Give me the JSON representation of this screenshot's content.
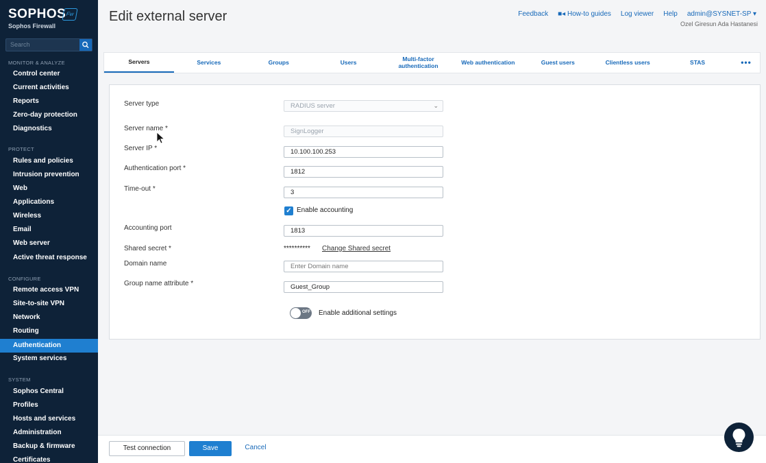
{
  "sidebar": {
    "brand": "SOPHOS",
    "brand_sub": "Sophos Firewall",
    "badge": "Fw",
    "search_placeholder": "Search",
    "sections": {
      "monitor": "MONITOR & ANALYZE",
      "protect": "PROTECT",
      "configure": "CONFIGURE",
      "system": "SYSTEM"
    },
    "monitor_items": [
      "Control center",
      "Current activities",
      "Reports",
      "Zero-day protection",
      "Diagnostics"
    ],
    "protect_items": [
      "Rules and policies",
      "Intrusion prevention",
      "Web",
      "Applications",
      "Wireless",
      "Email",
      "Web server",
      "Active threat response"
    ],
    "configure_items": [
      "Remote access VPN",
      "Site-to-site VPN",
      "Network",
      "Routing",
      "Authentication",
      "System services"
    ],
    "system_items": [
      "Sophos Central",
      "Profiles",
      "Hosts and services",
      "Administration",
      "Backup & firmware",
      "Certificates"
    ],
    "active_item": "Authentication"
  },
  "header": {
    "title": "Edit external server",
    "links": [
      "Feedback",
      "How-to guides",
      "Log viewer",
      "Help"
    ],
    "user": "admin@SYSNET-SP",
    "org": "Ozel Giresun Ada Hastanesi"
  },
  "tabs": [
    {
      "label": "Servers",
      "active": true
    },
    {
      "label": "Services"
    },
    {
      "label": "Groups"
    },
    {
      "label": "Users"
    },
    {
      "label": "Multi-factor authentication"
    },
    {
      "label": "Web authentication"
    },
    {
      "label": "Guest users"
    },
    {
      "label": "Clientless users"
    },
    {
      "label": "STAS"
    },
    {
      "label": "•••"
    }
  ],
  "form": {
    "server_type": {
      "label": "Server type",
      "value": "RADIUS server"
    },
    "server_name": {
      "label": "Server name *",
      "value": "SignLogger"
    },
    "server_ip": {
      "label": "Server IP *",
      "value": "10.100.100.253"
    },
    "auth_port": {
      "label": "Authentication port *",
      "value": "1812"
    },
    "timeout": {
      "label": "Time-out *",
      "value": "3"
    },
    "accounting": {
      "label": "Enable accounting",
      "checked": true
    },
    "accounting_port": {
      "label": "Accounting port",
      "value": "1813"
    },
    "shared_secret": {
      "label": "Shared secret *",
      "masked": "**********",
      "link": "Change Shared secret"
    },
    "domain_name": {
      "label": "Domain name",
      "placeholder": "Enter Domain name"
    },
    "group_attr": {
      "label": "Group name attribute *",
      "value": "Guest_Group"
    },
    "additional": {
      "label": "Enable additional settings",
      "toggle": "OFF"
    }
  },
  "footer": {
    "test": "Test connection",
    "save": "Save",
    "cancel": "Cancel"
  },
  "colors": {
    "sidebar_bg": "#0e2238",
    "accent": "#1f7fd0",
    "link": "#1769b9"
  }
}
